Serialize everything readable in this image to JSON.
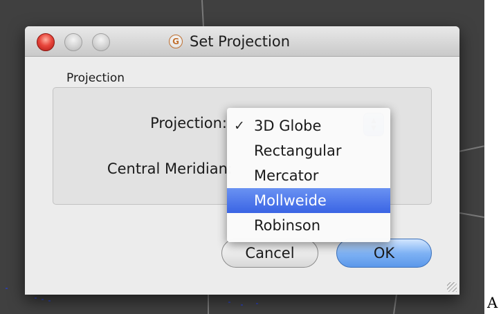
{
  "dialog": {
    "title": "Set Projection",
    "app_icon_glyph": "G"
  },
  "group": {
    "title": "Projection"
  },
  "fields": {
    "projection_label": "Projection:",
    "central_meridian_label": "Central Meridian:"
  },
  "dropdown": {
    "selected": "3D Globe",
    "highlighted": "Mollweide",
    "check_mark": "✓",
    "options": [
      "3D Globe",
      "Rectangular",
      "Mercator",
      "Mollweide",
      "Robinson"
    ]
  },
  "buttons": {
    "cancel": "Cancel",
    "ok": "OK"
  },
  "outside_text": "A",
  "colors": {
    "highlight": "#3a64e4",
    "default_button": "#7fb2f4",
    "close_button": "#e8463c",
    "desktop": "#404040"
  }
}
